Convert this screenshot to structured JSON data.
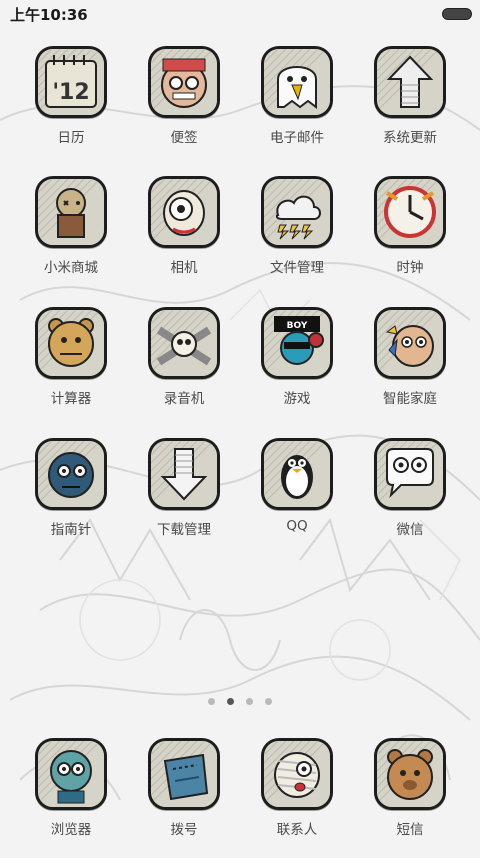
{
  "status": {
    "time": "上午10:36"
  },
  "apps": [
    {
      "label": "日历",
      "icon": "calendar-icon",
      "kind": "calendar",
      "text": "'12"
    },
    {
      "label": "便签",
      "icon": "notes-icon",
      "kind": "face-glasses"
    },
    {
      "label": "电子邮件",
      "icon": "email-icon",
      "kind": "ghost"
    },
    {
      "label": "系统更新",
      "icon": "system-update-icon",
      "kind": "arrow-up"
    },
    {
      "label": "小米商城",
      "icon": "mi-store-icon",
      "kind": "voodoo"
    },
    {
      "label": "相机",
      "icon": "camera-icon",
      "kind": "cyclops"
    },
    {
      "label": "文件管理",
      "icon": "file-manager-icon",
      "kind": "cloud"
    },
    {
      "label": "时钟",
      "icon": "clock-icon",
      "kind": "clock"
    },
    {
      "label": "计算器",
      "icon": "calculator-icon",
      "kind": "bear"
    },
    {
      "label": "录音机",
      "icon": "recorder-icon",
      "kind": "skull"
    },
    {
      "label": "游戏",
      "icon": "game-icon",
      "kind": "boy",
      "text": "BOY"
    },
    {
      "label": "智能家庭",
      "icon": "smart-home-icon",
      "kind": "old-man"
    },
    {
      "label": "指南针",
      "icon": "compass-icon",
      "kind": "zombie"
    },
    {
      "label": "下载管理",
      "icon": "download-icon",
      "kind": "arrow-down"
    },
    {
      "label": "QQ",
      "icon": "qq-icon",
      "kind": "penguin"
    },
    {
      "label": "微信",
      "icon": "wechat-icon",
      "kind": "bubbles"
    }
  ],
  "pager": {
    "pages": 4,
    "current": 2
  },
  "dock": [
    {
      "label": "浏览器",
      "icon": "browser-icon",
      "kind": "teal-zombie"
    },
    {
      "label": "拨号",
      "icon": "phone-icon",
      "kind": "blue-pouch"
    },
    {
      "label": "联系人",
      "icon": "contacts-icon",
      "kind": "mummy"
    },
    {
      "label": "短信",
      "icon": "sms-icon",
      "kind": "teddy"
    }
  ]
}
